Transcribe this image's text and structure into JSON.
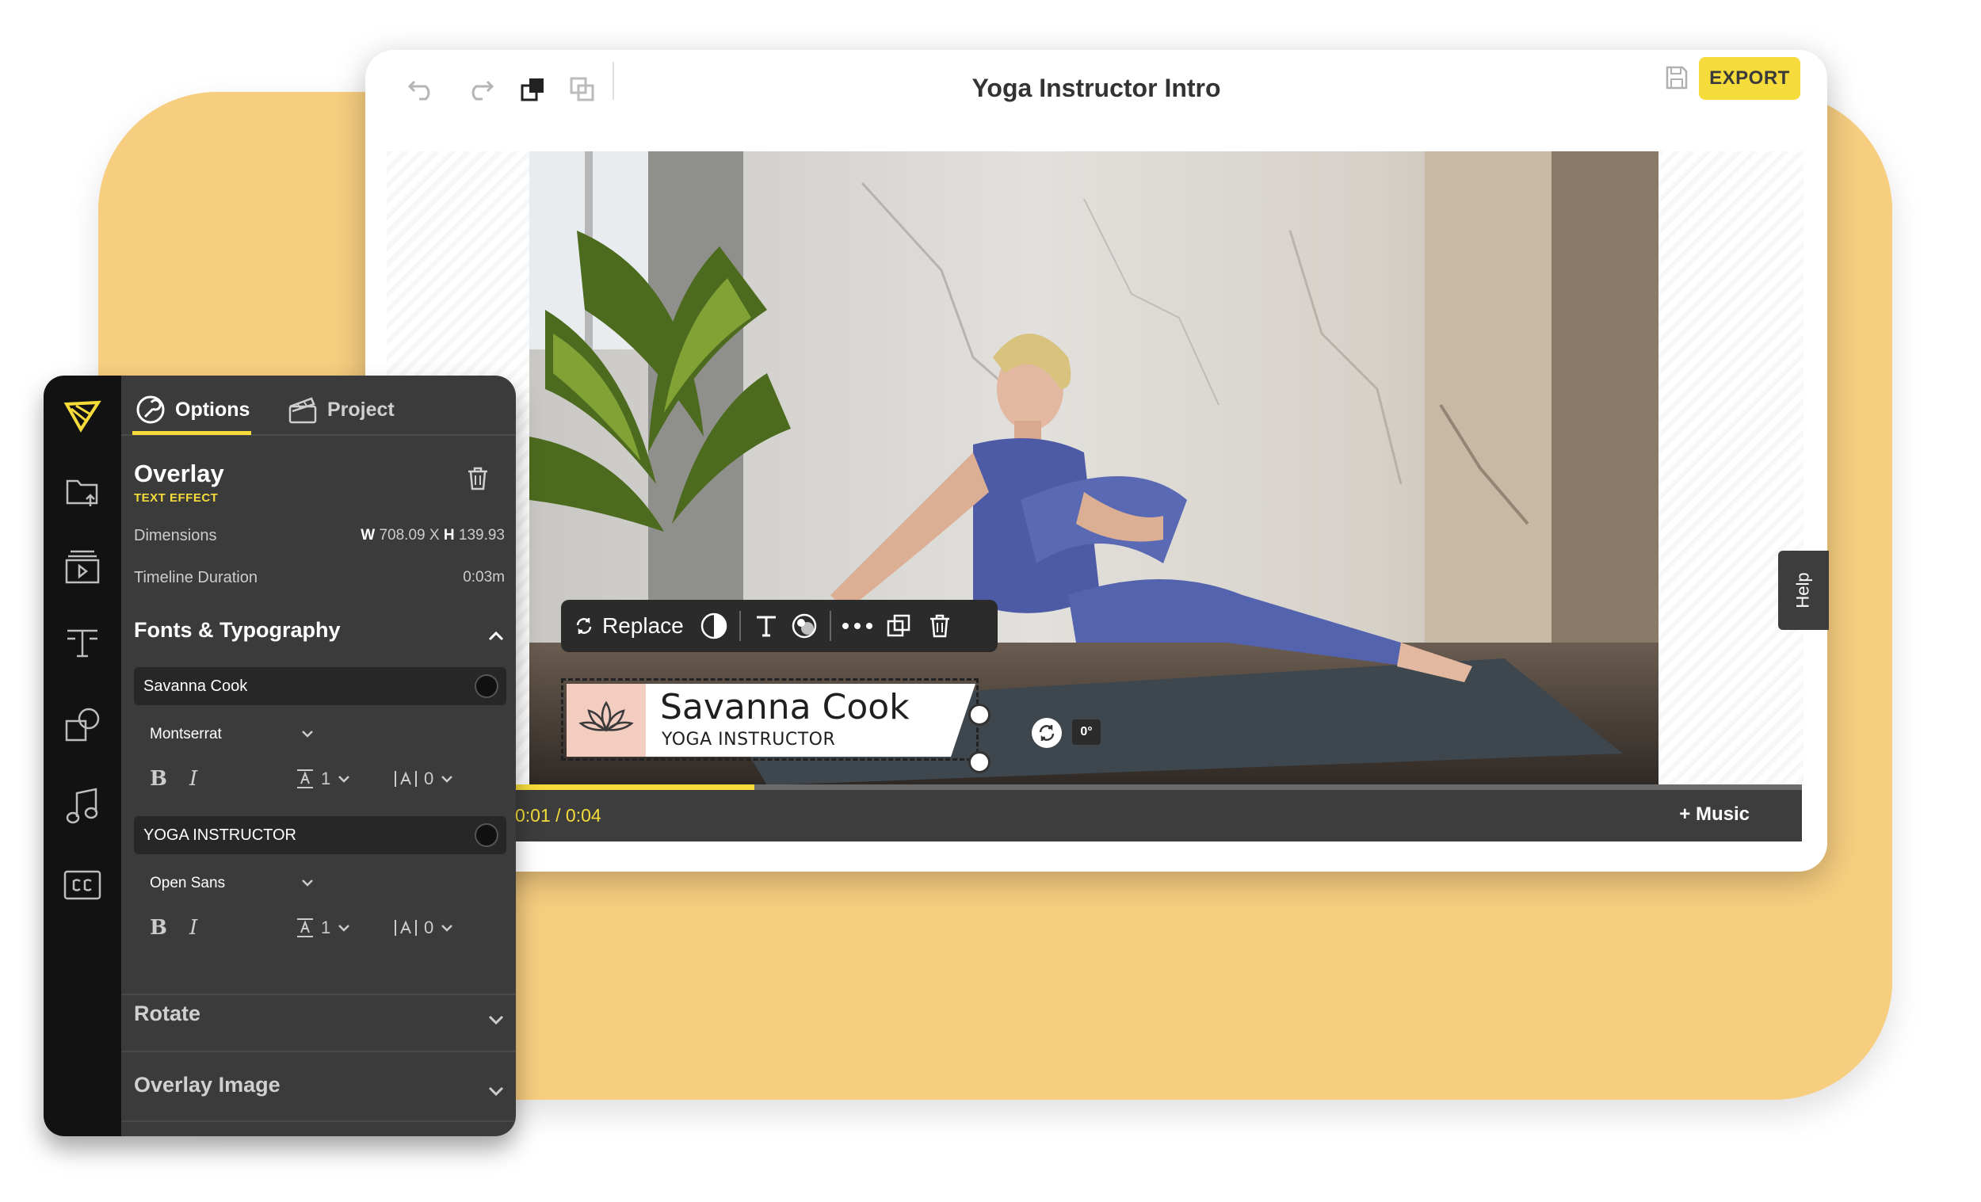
{
  "editor": {
    "title": "Yoga Instructor Intro",
    "export_label": "EXPORT",
    "icons": [
      "undo-icon",
      "redo-icon",
      "bring-forward-icon",
      "send-backward-icon",
      "save-icon"
    ]
  },
  "overlay_card": {
    "name": "Savanna Cook",
    "role": "YOGA INSTRUCTOR",
    "angle": "0°"
  },
  "floating_toolbar": {
    "replace_label": "Replace",
    "icons": [
      "replace-icon",
      "contrast-icon",
      "text-icon",
      "color-icon",
      "more-icon",
      "duplicate-icon",
      "delete-icon"
    ]
  },
  "help_label": "Help",
  "timeline": {
    "time": "0:01 / 0:04",
    "progress": 0.19,
    "music_label": "+ Music"
  },
  "panel": {
    "tabs": {
      "options": "Options",
      "project": "Project"
    },
    "rail_icons": [
      "logo-icon",
      "upload-folder-icon",
      "media-library-icon",
      "text-tool-icon",
      "shapes-icon",
      "music-icon",
      "captions-icon"
    ],
    "overlay": {
      "title": "Overlay",
      "subtitle": "TEXT EFFECT"
    },
    "dimensions": {
      "label": "Dimensions",
      "w_prefix": "W",
      "w_value": "708.09",
      "sep": "X",
      "h_prefix": "H",
      "h_value": "139.93"
    },
    "duration": {
      "label": "Timeline Duration",
      "value": "0:03m"
    },
    "fonts_section": "Fonts & Typography",
    "text_items": [
      {
        "text": "Savanna Cook",
        "font": "Montserrat",
        "bold": "B",
        "italic": "I",
        "line_height": "1",
        "letter_spacing": "0"
      },
      {
        "text": "YOGA INSTRUCTOR",
        "font": "Open Sans",
        "bold": "B",
        "italic": "I",
        "line_height": "1",
        "letter_spacing": "0"
      }
    ],
    "rotate_section": "Rotate",
    "overlay_image_section": "Overlay Image"
  },
  "colors": {
    "accent": "#f5dc3a",
    "background_card": "#f7cd7f",
    "panel": "#3b3b3b",
    "rail": "#121212"
  }
}
